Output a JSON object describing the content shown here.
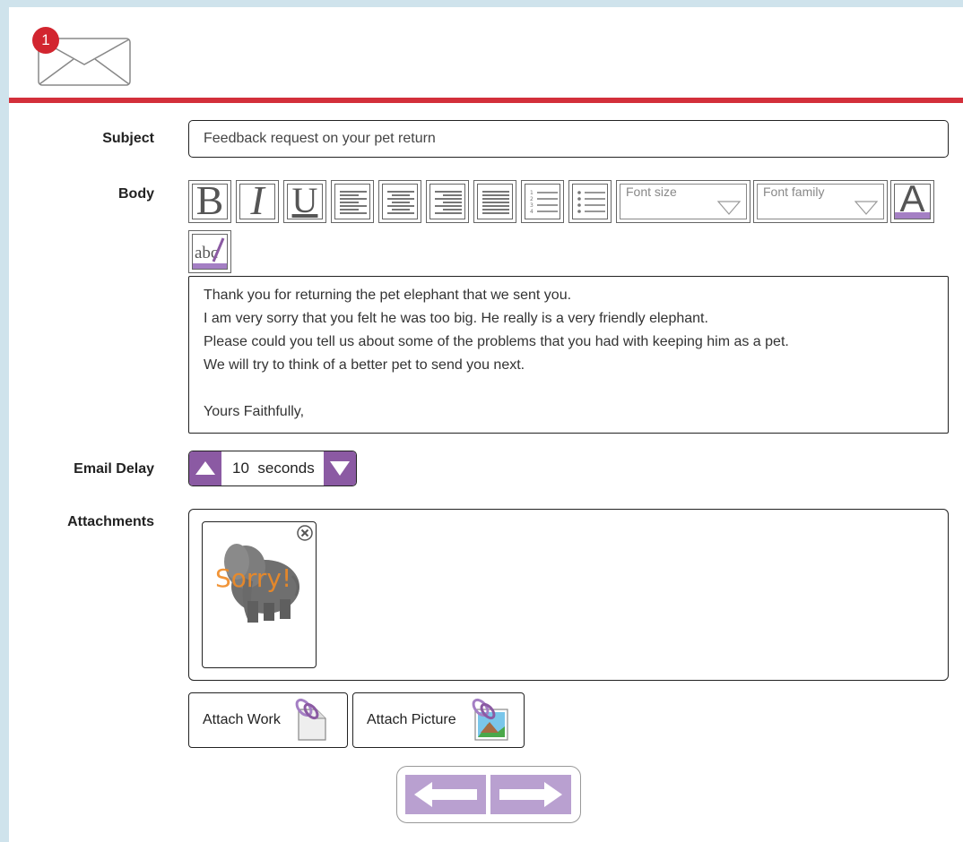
{
  "header": {
    "notification_count": "1",
    "icon": "envelope-icon",
    "accent_color": "#d32f3a"
  },
  "form": {
    "subject_label": "Subject",
    "subject_value": "Feedback request on your pet return",
    "body_label": "Body",
    "email_delay_label": "Email Delay",
    "attachments_label": "Attachments"
  },
  "toolbar": {
    "bold_glyph": "B",
    "italic_glyph": "I",
    "underline_glyph": "U",
    "font_size_placeholder": "Font size",
    "font_family_placeholder": "Font family",
    "font_color_glyph": "A",
    "spellcheck_glyph": "abc",
    "accent_color": "#a47fc4"
  },
  "body": {
    "text": "Thank you for returning the pet elephant that we sent you.\n I am very sorry that you felt he was too big.  He really is a very friendly elephant.\nPlease could you tell us about some of the problems that you had with keeping him as a pet.\nWe will try to think of a better pet to send you next.\n\nYours Faithfully,"
  },
  "delay": {
    "value": "10",
    "unit": "seconds",
    "button_color": "#8b5aa3"
  },
  "attachments": {
    "items": [
      {
        "image_text": "Sorry!",
        "icon": "elephant-image"
      }
    ],
    "attach_work_label": "Attach Work",
    "attach_picture_label": "Attach Picture"
  },
  "nav": {
    "back_icon": "arrow-left-icon",
    "next_icon": "arrow-right-icon",
    "button_color": "#b9a0d0"
  }
}
